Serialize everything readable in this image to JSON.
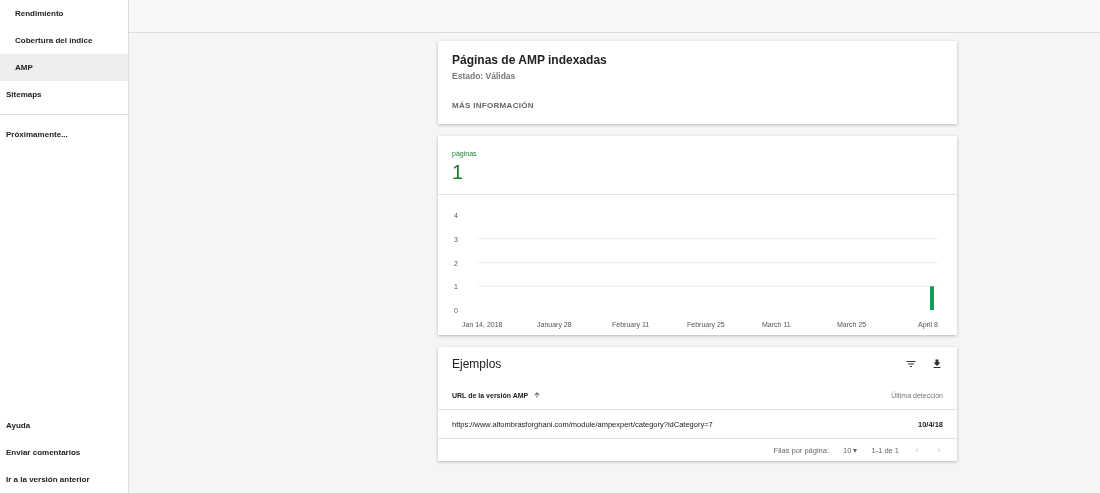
{
  "sidebar": {
    "items": [
      {
        "label": "Rendimiento",
        "indent": true,
        "selected": false
      },
      {
        "label": "Cobertura del índice",
        "indent": true,
        "selected": false
      },
      {
        "label": "AMP",
        "indent": true,
        "selected": true
      },
      {
        "label": "Sitemaps",
        "indent": false,
        "selected": false
      }
    ],
    "upcoming": "Próximamente...",
    "footer": [
      "Ayuda",
      "Enviar comentarios",
      "Ir a la versión anterior"
    ]
  },
  "summary": {
    "title": "Páginas de AMP indexadas",
    "status": "Estado: Válidas",
    "link": "MÁS INFORMACIÓN"
  },
  "metric": {
    "label": "páginas",
    "value": "1",
    "chart_data": {
      "type": "bar",
      "categories": [
        "Jan 14, 2018",
        "January 28",
        "February 11",
        "February 25",
        "March 11",
        "March 25",
        "April 8"
      ],
      "series": [
        {
          "color": "#0f9d58",
          "values": [
            0,
            0,
            0,
            0,
            0,
            0,
            1
          ]
        }
      ],
      "grid": true,
      "ylim": [
        0,
        4
      ],
      "yticks": [
        0,
        1,
        2,
        3,
        4
      ]
    }
  },
  "examples": {
    "title": "Ejemplos",
    "columns": [
      "URL de la versión AMP",
      "Última detección"
    ],
    "rows": [
      [
        "https://www.alfombrasforghani.com/module/ampexpert/category?idCategory=7",
        "10/4/18"
      ]
    ],
    "pagination": {
      "rows_label": "Filas por página:",
      "rows_value": "10",
      "rows_caret": "▾",
      "range": "1-1 de 1"
    }
  }
}
